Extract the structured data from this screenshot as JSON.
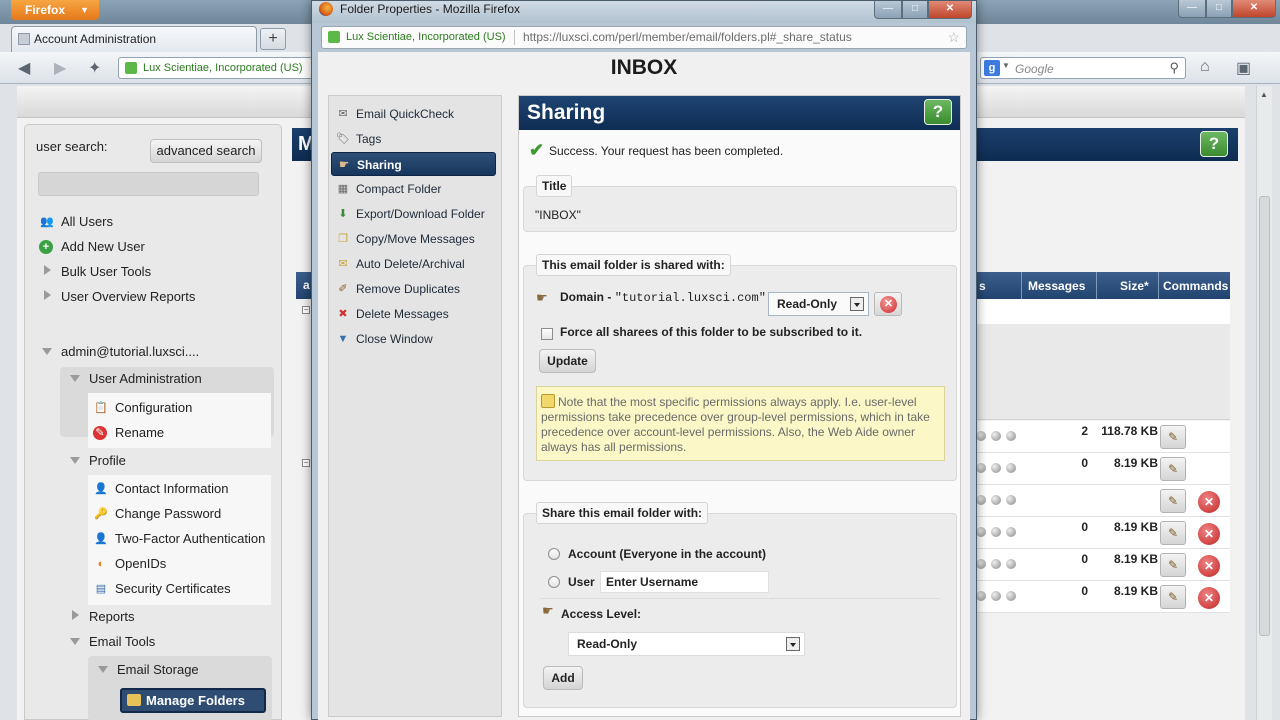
{
  "background_window": {
    "app_button": "Firefox",
    "tab_title": "Account Administration",
    "site_identity": "Lux Scientiae, Incorporated (US)",
    "search_placeholder": "Google",
    "left_panel": {
      "user_search_label": "user search:",
      "advanced_search_button": "advanced search",
      "items": {
        "all_users": "All Users",
        "add_new_user": "Add New User",
        "bulk_user_tools": "Bulk User Tools",
        "user_overview_reports": "User Overview Reports",
        "account": "admin@tutorial.luxsci....",
        "user_administration": "User Administration",
        "configuration": "Configuration",
        "rename": "Rename",
        "profile": "Profile",
        "contact_information": "Contact Information",
        "change_password": "Change Password",
        "two_factor": "Two-Factor Authentication",
        "openids": "OpenIDs",
        "security_certificates": "Security Certificates",
        "reports": "Reports",
        "email_tools": "Email Tools",
        "email_storage": "Email Storage",
        "manage_folders": "Manage Folders"
      }
    },
    "left_header_letter": "M",
    "table_left_header_letter": "a",
    "table": {
      "headers": {
        "col_s": "s",
        "messages": "Messages",
        "size": "Size*",
        "commands": "Commands"
      },
      "rows": [
        {
          "messages": "2",
          "size": "118.78 KB",
          "delete": false
        },
        {
          "messages": "0",
          "size": "8.19 KB",
          "delete": false
        },
        {
          "messages": "",
          "size": "",
          "delete": true
        },
        {
          "messages": "0",
          "size": "8.19 KB",
          "delete": true
        },
        {
          "messages": "0",
          "size": "8.19 KB",
          "delete": true
        },
        {
          "messages": "0",
          "size": "8.19 KB",
          "delete": true
        }
      ]
    },
    "help_label": "?"
  },
  "popup": {
    "window_title": "Folder Properties - Mozilla Firefox",
    "site_identity": "Lux Scientiae, Incorporated (US)",
    "url": "https://luxsci.com/perl/member/email/folders.pl#_share_status",
    "page_heading": "INBOX",
    "menu": [
      {
        "label": "Email QuickCheck",
        "icon": "envelope-check-icon",
        "active": false
      },
      {
        "label": "Tags",
        "icon": "tag-icon",
        "active": false
      },
      {
        "label": "Sharing",
        "icon": "share-icon",
        "active": true
      },
      {
        "label": "Compact Folder",
        "icon": "compact-icon",
        "active": false
      },
      {
        "label": "Export/Download Folder",
        "icon": "download-icon",
        "active": false
      },
      {
        "label": "Copy/Move Messages",
        "icon": "copy-icon",
        "active": false
      },
      {
        "label": "Auto Delete/Archival",
        "icon": "archive-icon",
        "active": false
      },
      {
        "label": "Remove Duplicates",
        "icon": "broom-icon",
        "active": false
      },
      {
        "label": "Delete Messages",
        "icon": "delete-icon",
        "active": false
      },
      {
        "label": "Close Window",
        "icon": "close-arrow-icon",
        "active": false
      }
    ],
    "sharing": {
      "title": "Sharing",
      "help": "?",
      "success_message": "Success. Your request has been completed.",
      "title_legend": "Title",
      "title_value": "\"INBOX\"",
      "shared_with_legend": "This email folder is shared with:",
      "share_entry": {
        "type": "Domain",
        "separator": " - ",
        "value": "\"tutorial.luxsci.com\"",
        "permission": "Read-Only"
      },
      "force_subscribe_label": "Force all sharees of this folder to be subscribed to it.",
      "update_button": "Update",
      "note": "Note that the most specific permissions always apply. I.e. user-level permissions take precedence over group-level permissions, which in take precedence over account-level permissions. Also, the Web Aide owner always has all permissions.",
      "share_with_legend": "Share this email folder with:",
      "option_account": "Account (Everyone in the account)",
      "option_user": "User",
      "username_placeholder": "Enter Username",
      "access_level_label": "Access Level:",
      "access_level_value": "Read-Only",
      "add_button": "Add"
    }
  }
}
